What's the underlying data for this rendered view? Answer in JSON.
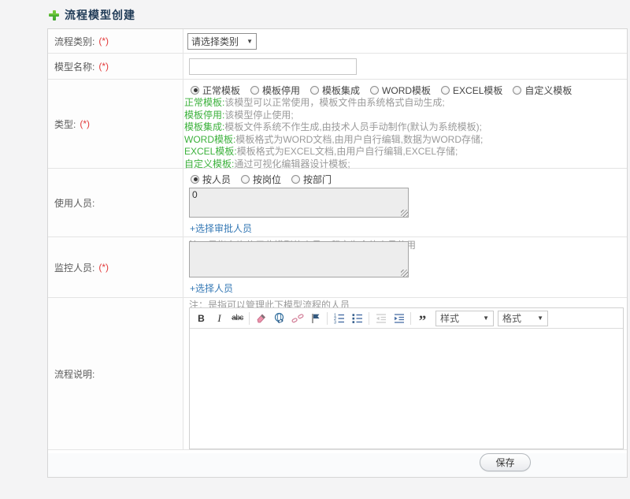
{
  "colors": {
    "accent_green": "#3cb13c",
    "link_blue": "#3679b5",
    "required_red": "#e23b3b",
    "title_navy": "#1f3a56"
  },
  "header": {
    "title": "流程模型创建"
  },
  "form": {
    "category": {
      "label": "流程类别:",
      "required": "(*)",
      "selected_option": "请选择类别",
      "caret": "▼"
    },
    "model_name": {
      "label": "模型名称:",
      "required": "(*)",
      "value": ""
    },
    "type": {
      "label": "类型:",
      "required": "(*)",
      "options": [
        "正常模板",
        "模板停用",
        "模板集成",
        "WORD模板",
        "EXCEL模板",
        "自定义模板"
      ],
      "selected_option": "正常模板",
      "descriptions": [
        {
          "term": "正常模板:",
          "text": "该模型可以正常使用，模板文件由系统格式自动生成;"
        },
        {
          "term": "模板停用:",
          "text": "该模型停止使用;"
        },
        {
          "term": "模板集成:",
          "text": "模板文件系统不作生成,由技术人员手动制作(默认为系统模板);"
        },
        {
          "term": "WORD模板:",
          "text": "模板格式为WORD文档,由用户自行编辑,数据为WORD存储;"
        },
        {
          "term": "EXCEL模板:",
          "text": "模板格式为EXCEL文档,由用户自行编辑,EXCEL存储;"
        },
        {
          "term": "自定义模板:",
          "text": "通过可视化编辑器设计模板;"
        }
      ]
    },
    "users": {
      "label": "使用人员:",
      "options": [
        "按人员",
        "按岗位",
        "按部门"
      ],
      "selected_option": "按人员",
      "value": "0",
      "link": "+选择审批人员",
      "note": "注：是指允许使用此模型的人员，留空为全体人员使用"
    },
    "monitors": {
      "label": "监控人员:",
      "required": "(*)",
      "value": "",
      "link": "+选择人员",
      "note": "注：是指可以管理此下模型流程的人员"
    },
    "description": {
      "label": "流程说明:",
      "editor": {
        "bold": "B",
        "italic": "I",
        "strike": "abc",
        "quote": "”",
        "styles_label": "样式",
        "format_label": "格式",
        "caret": "▼",
        "content": ""
      }
    },
    "save_label": "保存"
  }
}
